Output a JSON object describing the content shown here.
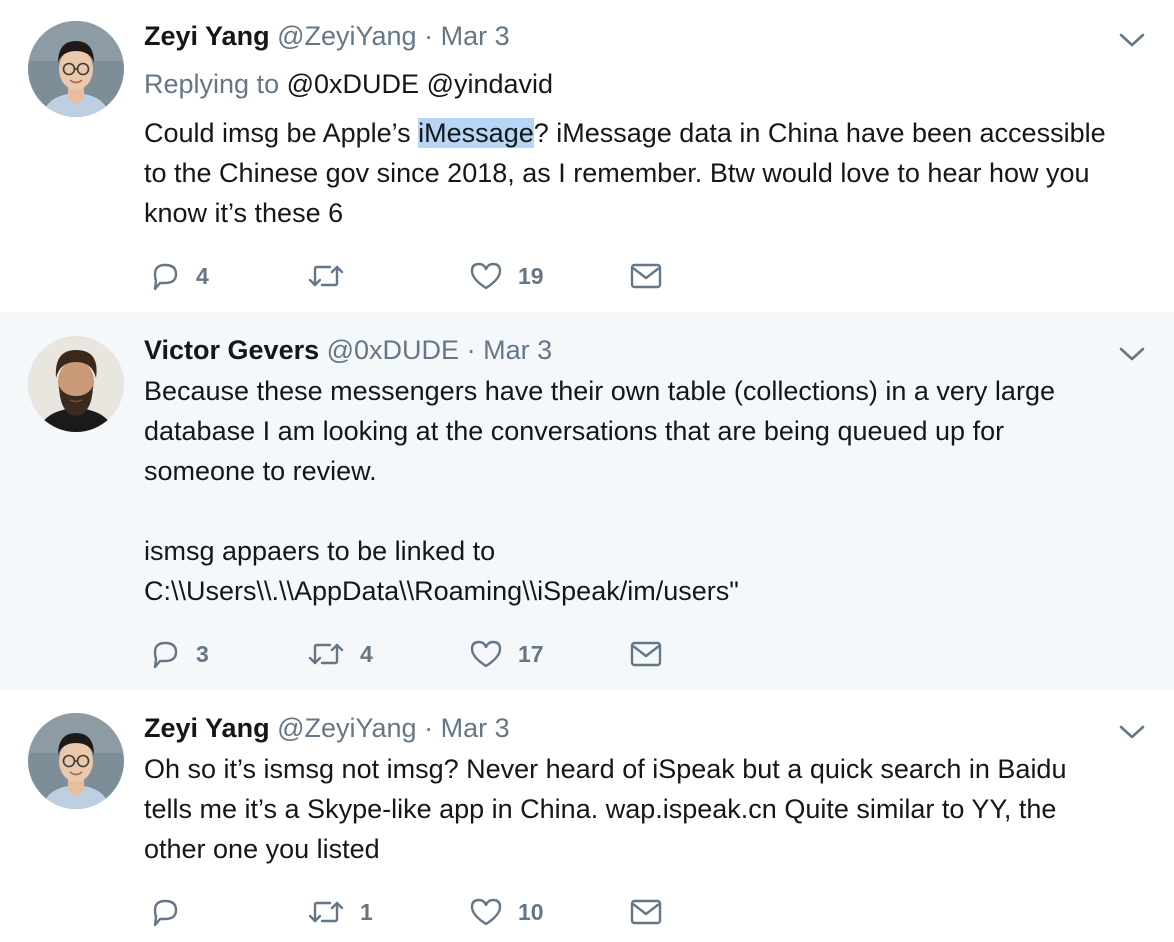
{
  "tweets": [
    {
      "name": "Zeyi Yang",
      "handle": "@ZeyiYang",
      "separator": "·",
      "date": "Mar 3",
      "replying_label": "Replying to",
      "replying_to": [
        "@0xDUDE",
        "@yindavid"
      ],
      "body_lines": [
        [
          "Could imsg be Apple’s ",
          "iMessage",
          "? iMessage data in China have been accessible"
        ],
        "to the Chinese gov since 2018, as I remember. Btw would love to hear how you",
        "know it’s these 6"
      ],
      "highlighted_text": "iMessage",
      "replies": "4",
      "retweets": "",
      "likes": "19"
    },
    {
      "name": "Victor Gevers",
      "handle": "@0xDUDE",
      "separator": "·",
      "date": "Mar 3",
      "body_lines": [
        "Because these messengers have their own table (collections) in a very large",
        "database I am looking at the conversations that are being queued up for",
        "someone to review.",
        "",
        "ismsg appaers to be linked to",
        "C:\\\\Users\\\\.\\\\AppData\\\\Roaming\\\\iSpeak/im/users\""
      ],
      "replies": "3",
      "retweets": "4",
      "likes": "17"
    },
    {
      "name": "Zeyi Yang",
      "handle": "@ZeyiYang",
      "separator": "·",
      "date": "Mar 3",
      "body_lines": [
        "Oh so it’s ismsg not imsg? Never heard of iSpeak but a quick search in Baidu",
        "tells me it’s a Skype-like app in China. wap.ispeak.cn Quite similar to YY, the",
        "other one you listed"
      ],
      "replies": "",
      "retweets": "1",
      "likes": "10"
    }
  ],
  "icons": {
    "reply": "reply-icon",
    "retweet": "retweet-icon",
    "like": "heart-icon",
    "message": "direct-message-icon",
    "menu": "chevron-down-icon"
  },
  "colors": {
    "text": "#14171a",
    "secondary": "#657786",
    "selected_bg": "#f5f8fa",
    "thread_line": "#ccd6dd",
    "highlight": "#b7d5f5"
  }
}
